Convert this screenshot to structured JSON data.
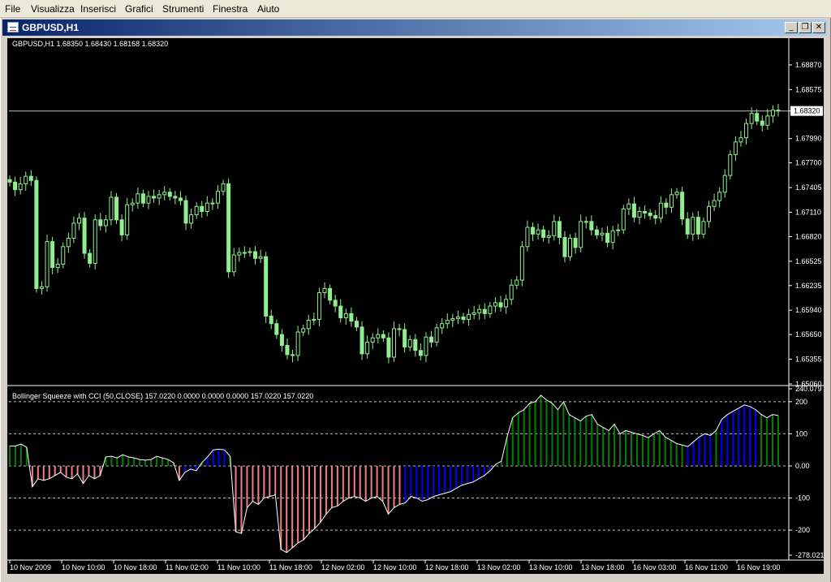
{
  "menu": {
    "items": [
      "File",
      "Visualizza",
      "Inserisci",
      "Grafici",
      "Strumenti",
      "Finestra",
      "Aiuto"
    ]
  },
  "window": {
    "title": "GBPUSD,H1",
    "icon": "chart-window-icon",
    "buttons": [
      {
        "name": "minimize-button",
        "glyph": "_",
        "icon": "minimize-icon"
      },
      {
        "name": "restore-button",
        "glyph": "❐",
        "icon": "restore-icon"
      },
      {
        "name": "close-button",
        "glyph": "✕",
        "icon": "close-icon"
      }
    ]
  },
  "colors": {
    "background": "#000000",
    "candle": "#90ee90",
    "grid": "#c0c0c0",
    "axis_text": "#ffffff",
    "green_bars": "#008000",
    "red_bars": "#f08080",
    "blue_bars": "#0000ff",
    "cci_line": "#ffffff",
    "price_line": "#c0c0c0"
  },
  "chart_data": [
    {
      "type": "candlestick",
      "header": "GBPUSD,H1  1.68350 1.68430 1.68168 1.68320",
      "current_price": 1.6832,
      "ylim": [
        1.6506,
        1.6917
      ],
      "y_ticks": [
        1.6887,
        1.68575,
        1.6832,
        1.6799,
        1.677,
        1.67405,
        1.6711,
        1.6682,
        1.66525,
        1.66235,
        1.6594,
        1.6565,
        1.65355,
        1.6506
      ],
      "y_tick_labels": [
        "1.68870",
        "1.68575",
        "1.68320",
        "1.67990",
        "1.67700",
        "1.67405",
        "1.67110",
        "1.66820",
        "1.66525",
        "1.66235",
        "1.65940",
        "1.65650",
        "1.65355",
        "1.65060"
      ],
      "closes": [
        1.6747,
        1.6738,
        1.6745,
        1.6754,
        1.6749,
        1.662,
        1.6622,
        1.6676,
        1.6645,
        1.6649,
        1.667,
        1.668,
        1.6698,
        1.6704,
        1.6662,
        1.665,
        1.6702,
        1.6695,
        1.6702,
        1.6729,
        1.6702,
        1.6684,
        1.672,
        1.6722,
        1.6733,
        1.6722,
        1.673,
        1.6728,
        1.6732,
        1.6735,
        1.673,
        1.6728,
        1.6725,
        1.6698,
        1.6708,
        1.6718,
        1.6712,
        1.6722,
        1.6722,
        1.6736,
        1.6745,
        1.664,
        1.666,
        1.6663,
        1.6663,
        1.6664,
        1.6656,
        1.6658,
        1.6587,
        1.6578,
        1.6565,
        1.6552,
        1.6541,
        1.654,
        1.6568,
        1.6572,
        1.6582,
        1.6583,
        1.6615,
        1.662,
        1.6606,
        1.6599,
        1.6585,
        1.659,
        1.6581,
        1.6574,
        1.6542,
        1.6556,
        1.6561,
        1.6565,
        1.6561,
        1.6538,
        1.6572,
        1.6571,
        1.655,
        1.6559,
        1.6546,
        1.654,
        1.6562,
        1.6556,
        1.6573,
        1.6578,
        1.6582,
        1.6584,
        1.6586,
        1.6583,
        1.6589,
        1.6591,
        1.6595,
        1.659,
        1.6599,
        1.6603,
        1.6598,
        1.6607,
        1.6624,
        1.663,
        1.667,
        1.6693,
        1.6685,
        1.669,
        1.6681,
        1.6683,
        1.67,
        1.6681,
        1.6658,
        1.668,
        1.6669,
        1.67,
        1.67,
        1.669,
        1.6684,
        1.6686,
        1.6675,
        1.6689,
        1.669,
        1.6715,
        1.6721,
        1.6705,
        1.6712,
        1.671,
        1.6707,
        1.6704,
        1.6722,
        1.6717,
        1.6732,
        1.6735,
        1.6703,
        1.6685,
        1.6705,
        1.6685,
        1.67,
        1.6718,
        1.6725,
        1.6735,
        1.6755,
        1.678,
        1.6795,
        1.68,
        1.6817,
        1.6829,
        1.682,
        1.6815,
        1.6826,
        1.6833,
        1.6832
      ]
    },
    {
      "type": "bar",
      "header": "Bollinger Squeeze with CCI (50,CLOSE) 157.0220 0.0000 0.0000 0.0000 157.0220 157.0220",
      "ylim": [
        -278.021,
        240.079
      ],
      "y_ticks": [
        240.079,
        200,
        100,
        0,
        -100,
        -200,
        -278.021
      ],
      "y_tick_labels": [
        "240.079",
        "200",
        "100",
        "0.00",
        "-100",
        "-200",
        "-278.021"
      ],
      "x_tick_labels": [
        "10 Nov 2009",
        "10 Nov 10:00",
        "10 Nov 18:00",
        "11 Nov 02:00",
        "11 Nov 10:00",
        "11 Nov 18:00",
        "12 Nov 02:00",
        "12 Nov 10:00",
        "12 Nov 18:00",
        "13 Nov 02:00",
        "13 Nov 10:00",
        "13 Nov 18:00",
        "16 Nov 03:00",
        "16 Nov 11:00",
        "16 Nov 19:00"
      ],
      "values": [
        62,
        62,
        68,
        58,
        -65,
        -40,
        -45,
        -40,
        -30,
        -20,
        -35,
        -40,
        -25,
        -55,
        -30,
        -40,
        -30,
        28,
        30,
        25,
        35,
        28,
        25,
        20,
        18,
        20,
        30,
        25,
        20,
        10,
        -45,
        -20,
        -10,
        -15,
        10,
        28,
        50,
        52,
        50,
        30,
        -205,
        -210,
        -130,
        -110,
        -120,
        -100,
        -95,
        -90,
        -260,
        -270,
        -255,
        -240,
        -230,
        -210,
        -195,
        -175,
        -150,
        -130,
        -125,
        -110,
        -100,
        -95,
        -100,
        -110,
        -100,
        -95,
        -110,
        -150,
        -130,
        -120,
        -115,
        -95,
        -100,
        -110,
        -105,
        -95,
        -90,
        -85,
        -80,
        -70,
        -60,
        -55,
        -50,
        -40,
        -30,
        -15,
        5,
        15,
        90,
        150,
        165,
        175,
        195,
        200,
        220,
        205,
        195,
        175,
        200,
        160,
        150,
        140,
        155,
        160,
        130,
        120,
        110,
        130,
        100,
        110,
        105,
        100,
        95,
        88,
        100,
        110,
        90,
        80,
        70,
        65,
        60,
        75,
        90,
        100,
        95,
        110,
        145,
        160,
        170,
        180,
        190,
        185,
        175,
        160,
        150,
        160,
        157
      ]
    }
  ]
}
